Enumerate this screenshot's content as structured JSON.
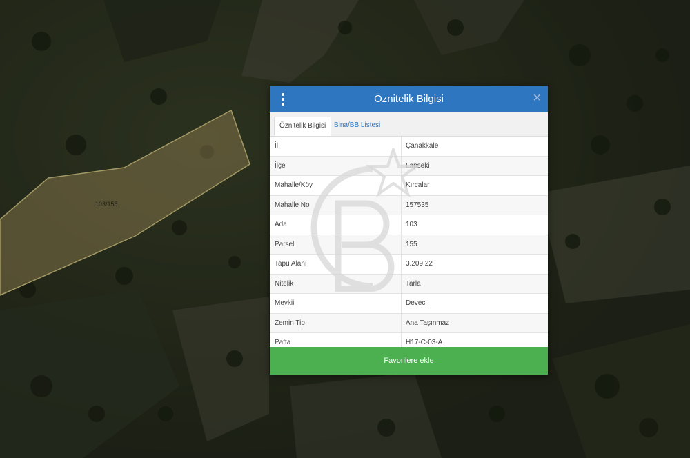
{
  "map": {
    "parcel_label": "103/155"
  },
  "dialog": {
    "title": "Öznitelik Bilgisi",
    "menu_icon": "kebab-menu-icon",
    "close_icon": "close-icon",
    "tabs": [
      {
        "label": "Öznitelik Bilgisi",
        "active": true
      },
      {
        "label": "Bina/BB Listesi",
        "active": false
      }
    ],
    "rows": [
      {
        "key": "İl",
        "value": "Çanakkale"
      },
      {
        "key": "İlçe",
        "value": "Lapseki"
      },
      {
        "key": "Mahalle/Köy",
        "value": "Kırcalar"
      },
      {
        "key": "Mahalle No",
        "value": "157535"
      },
      {
        "key": "Ada",
        "value": "103"
      },
      {
        "key": "Parsel",
        "value": "155"
      },
      {
        "key": "Tapu Alanı",
        "value": "3.209,22"
      },
      {
        "key": "Nitelik",
        "value": "Tarla"
      },
      {
        "key": "Mevkii",
        "value": "Deveci"
      },
      {
        "key": "Zemin Tip",
        "value": "Ana Taşınmaz"
      },
      {
        "key": "Pafta",
        "value": "H17-C-03-A"
      }
    ],
    "favorite_button": "Favorilere ekle"
  },
  "colors": {
    "header": "#2f76c1",
    "button": "#4caf50"
  }
}
